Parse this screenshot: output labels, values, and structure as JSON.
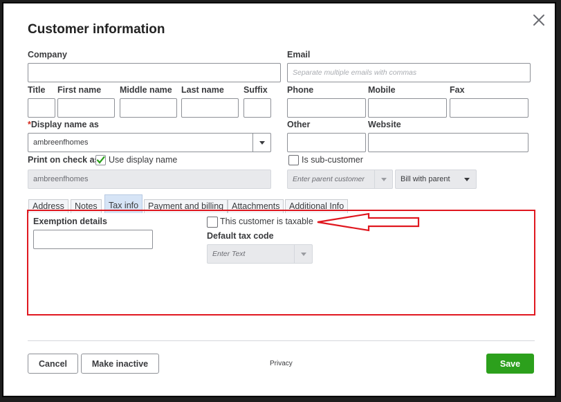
{
  "dialog": {
    "title": "Customer information"
  },
  "labels": {
    "company": "Company",
    "email": "Email",
    "title": "Title",
    "first_name": "First name",
    "middle_name": "Middle name",
    "last_name": "Last name",
    "suffix": "Suffix",
    "phone": "Phone",
    "mobile": "Mobile",
    "fax": "Fax",
    "display_name_required": "*",
    "display_name": "Display name as",
    "other": "Other",
    "website": "Website",
    "print_on_check": "Print on check as"
  },
  "fields": {
    "company_value": "",
    "email_placeholder": "Separate multiple emails with commas",
    "display_name_value": "ambreenfhomes",
    "print_on_check_value": "ambreenfhomes",
    "parent_customer_placeholder": "Enter parent customer",
    "bill_with_value": "Bill with parent"
  },
  "checkboxes": {
    "use_display_name": {
      "label": "Use display name",
      "checked": true
    },
    "is_sub_customer": {
      "label": "Is sub-customer",
      "checked": false
    },
    "customer_taxable": {
      "label": "This customer is taxable",
      "checked": false
    }
  },
  "tabs": [
    {
      "label": "Address",
      "active": false
    },
    {
      "label": "Notes",
      "active": false
    },
    {
      "label": "Tax info",
      "active": true
    },
    {
      "label": "Payment and billing",
      "active": false
    },
    {
      "label": "Attachments",
      "active": false
    },
    {
      "label": "Additional Info",
      "active": false
    }
  ],
  "tax_info": {
    "exemption_label": "Exemption details",
    "exemption_value": "",
    "default_tax_code_label": "Default tax code",
    "default_tax_code_placeholder": "Enter Text"
  },
  "footer": {
    "cancel": "Cancel",
    "make_inactive": "Make inactive",
    "privacy": "Privacy",
    "save": "Save"
  },
  "colors": {
    "brand_green": "#2ca01c",
    "annotation_red": "#e0171f",
    "active_tab": "#d6e4f6"
  }
}
